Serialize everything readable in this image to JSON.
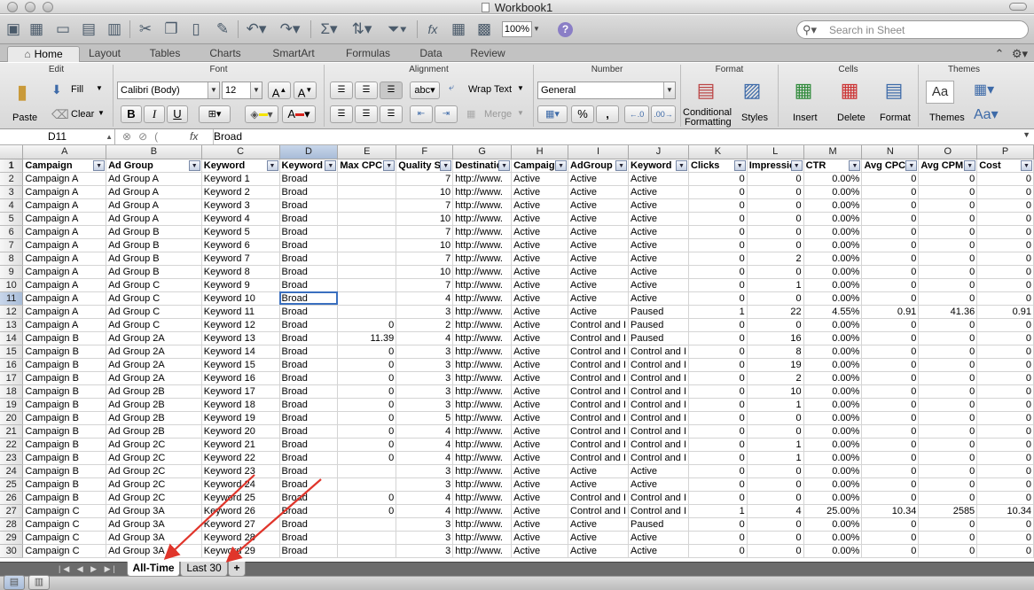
{
  "window": {
    "title": "Workbook1"
  },
  "toolbar": {
    "zoom": "100%",
    "search_placeholder": "Search in Sheet"
  },
  "ribbon_tabs": [
    "Home",
    "Layout",
    "Tables",
    "Charts",
    "SmartArt",
    "Formulas",
    "Data",
    "Review"
  ],
  "ribbon": {
    "groups": {
      "edit": "Edit",
      "font": "Font",
      "alignment": "Alignment",
      "number": "Number",
      "format": "Format",
      "cells": "Cells",
      "themes": "Themes"
    },
    "paste": "Paste",
    "fill": "Fill",
    "clear": "Clear",
    "font_name": "Calibri (Body)",
    "font_size": "12",
    "wrap_text": "Wrap Text",
    "merge": "Merge",
    "number_format": "General",
    "percent": "%",
    "comma": ",",
    "cond_fmt_1": "Conditional",
    "cond_fmt_2": "Formatting",
    "styles": "Styles",
    "insert": "Insert",
    "delete": "Delete",
    "format": "Format",
    "themes": "Themes"
  },
  "formula_bar": {
    "cell_ref": "D11",
    "content": "Broad",
    "fx": "fx"
  },
  "columns": [
    "A",
    "B",
    "C",
    "D",
    "E",
    "F",
    "G",
    "H",
    "I",
    "J",
    "K",
    "L",
    "M",
    "N",
    "O",
    "P"
  ],
  "header_row": [
    "Campaign",
    "Ad Group",
    "Keyword",
    "Keyword",
    "Max CPC",
    "Quality Sc",
    "Destinatio",
    "Campaign",
    "AdGroup",
    "Keyword",
    "Clicks",
    "Impressio",
    "CTR",
    "Avg CPC",
    "Avg CPM",
    "Cost"
  ],
  "rows": [
    [
      "Campaign A",
      "Ad Group A",
      "Keyword 1",
      "Broad",
      "",
      "7",
      "http://www.",
      "Active",
      "Active",
      "Active",
      "0",
      "0",
      "0.00%",
      "0",
      "0",
      "0"
    ],
    [
      "Campaign A",
      "Ad Group A",
      "Keyword 2",
      "Broad",
      "",
      "10",
      "http://www.",
      "Active",
      "Active",
      "Active",
      "0",
      "0",
      "0.00%",
      "0",
      "0",
      "0"
    ],
    [
      "Campaign A",
      "Ad Group A",
      "Keyword 3",
      "Broad",
      "",
      "7",
      "http://www.",
      "Active",
      "Active",
      "Active",
      "0",
      "0",
      "0.00%",
      "0",
      "0",
      "0"
    ],
    [
      "Campaign A",
      "Ad Group A",
      "Keyword 4",
      "Broad",
      "",
      "10",
      "http://www.",
      "Active",
      "Active",
      "Active",
      "0",
      "0",
      "0.00%",
      "0",
      "0",
      "0"
    ],
    [
      "Campaign A",
      "Ad Group B",
      "Keyword 5",
      "Broad",
      "",
      "7",
      "http://www.",
      "Active",
      "Active",
      "Active",
      "0",
      "0",
      "0.00%",
      "0",
      "0",
      "0"
    ],
    [
      "Campaign A",
      "Ad Group B",
      "Keyword 6",
      "Broad",
      "",
      "10",
      "http://www.",
      "Active",
      "Active",
      "Active",
      "0",
      "0",
      "0.00%",
      "0",
      "0",
      "0"
    ],
    [
      "Campaign A",
      "Ad Group B",
      "Keyword 7",
      "Broad",
      "",
      "7",
      "http://www.",
      "Active",
      "Active",
      "Active",
      "0",
      "2",
      "0.00%",
      "0",
      "0",
      "0"
    ],
    [
      "Campaign A",
      "Ad Group B",
      "Keyword 8",
      "Broad",
      "",
      "10",
      "http://www.",
      "Active",
      "Active",
      "Active",
      "0",
      "0",
      "0.00%",
      "0",
      "0",
      "0"
    ],
    [
      "Campaign A",
      "Ad Group C",
      "Keyword 9",
      "Broad",
      "",
      "7",
      "http://www.",
      "Active",
      "Active",
      "Active",
      "0",
      "1",
      "0.00%",
      "0",
      "0",
      "0"
    ],
    [
      "Campaign A",
      "Ad Group C",
      "Keyword 10",
      "Broad",
      "",
      "4",
      "http://www.",
      "Active",
      "Active",
      "Active",
      "0",
      "0",
      "0.00%",
      "0",
      "0",
      "0"
    ],
    [
      "Campaign A",
      "Ad Group C",
      "Keyword 11",
      "Broad",
      "",
      "3",
      "http://www.",
      "Active",
      "Active",
      "Paused",
      "1",
      "22",
      "4.55%",
      "0.91",
      "41.36",
      "0.91"
    ],
    [
      "Campaign A",
      "Ad Group C",
      "Keyword 12",
      "Broad",
      "0",
      "2",
      "http://www.",
      "Active",
      "Control and I",
      "Paused",
      "0",
      "0",
      "0.00%",
      "0",
      "0",
      "0"
    ],
    [
      "Campaign B",
      "Ad Group 2A",
      "Keyword 13",
      "Broad",
      "11.39",
      "4",
      "http://www.",
      "Active",
      "Control and I",
      "Paused",
      "0",
      "16",
      "0.00%",
      "0",
      "0",
      "0"
    ],
    [
      "Campaign B",
      "Ad Group 2A",
      "Keyword 14",
      "Broad",
      "0",
      "3",
      "http://www.",
      "Active",
      "Control and I",
      "Control and I",
      "0",
      "8",
      "0.00%",
      "0",
      "0",
      "0"
    ],
    [
      "Campaign B",
      "Ad Group 2A",
      "Keyword 15",
      "Broad",
      "0",
      "3",
      "http://www.",
      "Active",
      "Control and I",
      "Control and I",
      "0",
      "19",
      "0.00%",
      "0",
      "0",
      "0"
    ],
    [
      "Campaign B",
      "Ad Group 2A",
      "Keyword 16",
      "Broad",
      "0",
      "3",
      "http://www.",
      "Active",
      "Control and I",
      "Control and I",
      "0",
      "2",
      "0.00%",
      "0",
      "0",
      "0"
    ],
    [
      "Campaign B",
      "Ad Group 2B",
      "Keyword 17",
      "Broad",
      "0",
      "3",
      "http://www.",
      "Active",
      "Control and I",
      "Control and I",
      "0",
      "10",
      "0.00%",
      "0",
      "0",
      "0"
    ],
    [
      "Campaign B",
      "Ad Group 2B",
      "Keyword 18",
      "Broad",
      "0",
      "3",
      "http://www.",
      "Active",
      "Control and I",
      "Control and I",
      "0",
      "1",
      "0.00%",
      "0",
      "0",
      "0"
    ],
    [
      "Campaign B",
      "Ad Group 2B",
      "Keyword 19",
      "Broad",
      "0",
      "5",
      "http://www.",
      "Active",
      "Control and I",
      "Control and I",
      "0",
      "0",
      "0.00%",
      "0",
      "0",
      "0"
    ],
    [
      "Campaign B",
      "Ad Group 2B",
      "Keyword 20",
      "Broad",
      "0",
      "4",
      "http://www.",
      "Active",
      "Control and I",
      "Control and I",
      "0",
      "0",
      "0.00%",
      "0",
      "0",
      "0"
    ],
    [
      "Campaign B",
      "Ad Group 2C",
      "Keyword 21",
      "Broad",
      "0",
      "4",
      "http://www.",
      "Active",
      "Control and I",
      "Control and I",
      "0",
      "1",
      "0.00%",
      "0",
      "0",
      "0"
    ],
    [
      "Campaign B",
      "Ad Group 2C",
      "Keyword 22",
      "Broad",
      "0",
      "4",
      "http://www.",
      "Active",
      "Control and I",
      "Control and I",
      "0",
      "1",
      "0.00%",
      "0",
      "0",
      "0"
    ],
    [
      "Campaign B",
      "Ad Group 2C",
      "Keyword 23",
      "Broad",
      "",
      "3",
      "http://www.",
      "Active",
      "Active",
      "Active",
      "0",
      "0",
      "0.00%",
      "0",
      "0",
      "0"
    ],
    [
      "Campaign B",
      "Ad Group 2C",
      "Keyword 24",
      "Broad",
      "",
      "3",
      "http://www.",
      "Active",
      "Active",
      "Active",
      "0",
      "0",
      "0.00%",
      "0",
      "0",
      "0"
    ],
    [
      "Campaign B",
      "Ad Group 2C",
      "Keyword 25",
      "Broad",
      "0",
      "4",
      "http://www.",
      "Active",
      "Control and I",
      "Control and I",
      "0",
      "0",
      "0.00%",
      "0",
      "0",
      "0"
    ],
    [
      "Campaign C",
      "Ad Group 3A",
      "Keyword 26",
      "Broad",
      "0",
      "4",
      "http://www.",
      "Active",
      "Control and I",
      "Control and I",
      "1",
      "4",
      "25.00%",
      "10.34",
      "2585",
      "10.34"
    ],
    [
      "Campaign C",
      "Ad Group 3A",
      "Keyword 27",
      "Broad",
      "",
      "3",
      "http://www.",
      "Active",
      "Active",
      "Paused",
      "0",
      "0",
      "0.00%",
      "0",
      "0",
      "0"
    ],
    [
      "Campaign C",
      "Ad Group 3A",
      "Keyword 28",
      "Broad",
      "",
      "3",
      "http://www.",
      "Active",
      "Active",
      "Active",
      "0",
      "0",
      "0.00%",
      "0",
      "0",
      "0"
    ],
    [
      "Campaign C",
      "Ad Group 3A",
      "Keyword 29",
      "Broad",
      "",
      "3",
      "http://www.",
      "Active",
      "Active",
      "Active",
      "0",
      "0",
      "0.00%",
      "0",
      "0",
      "0"
    ]
  ],
  "sheet_tabs": [
    "All-Time",
    "Last 30"
  ],
  "active_sheet": "All-Time",
  "add_sheet": "+",
  "colors": {
    "annotation_arrow": "#e0352b",
    "selection": "#3a6fbf",
    "sheet_bar": "#6b6b6b"
  }
}
